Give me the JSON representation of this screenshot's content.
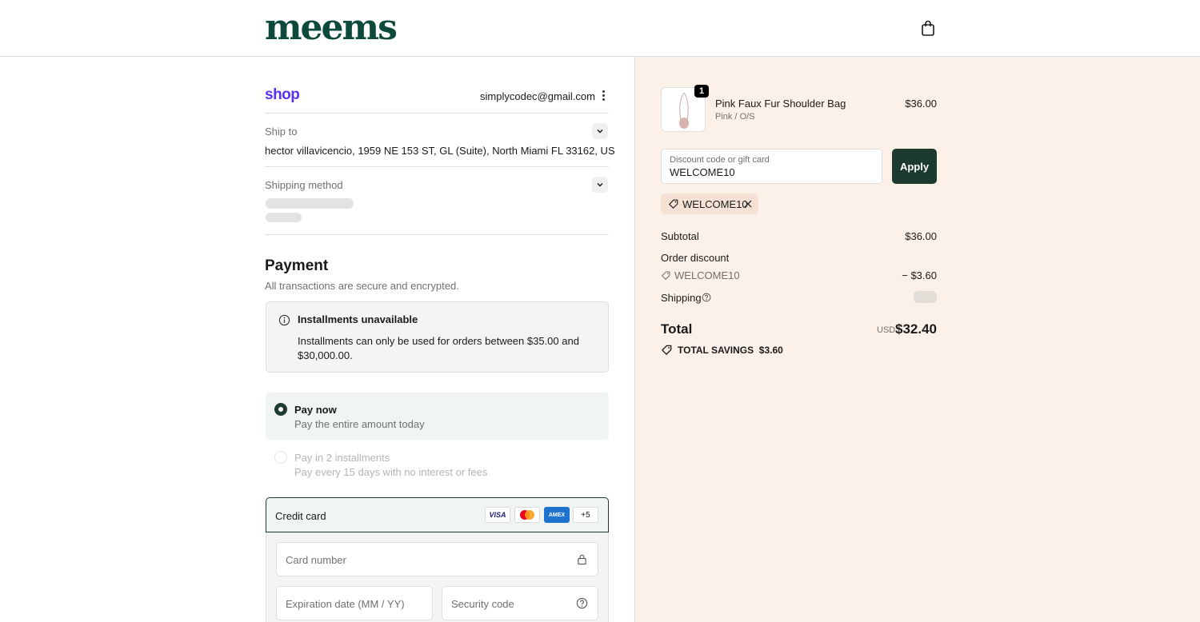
{
  "header": {
    "logo": "meems",
    "bag_icon": "shopping-bag-icon"
  },
  "account": {
    "provider": "shop",
    "email": "simplycodec@gmail.com"
  },
  "ship_to": {
    "label": "Ship to",
    "address": "hector villavicencio, 1959 NE 153 ST, GL (Suite), North Miami FL 33162, US"
  },
  "shipping_method": {
    "label": "Shipping method"
  },
  "payment": {
    "title": "Payment",
    "subtitle": "All transactions are secure and encrypted.",
    "notice": {
      "title": "Installments unavailable",
      "body": "Installments can only be used for orders between $35.00 and $30,000.00."
    },
    "options": [
      {
        "title": "Pay now",
        "subtitle": "Pay the entire amount today",
        "selected": true
      },
      {
        "title": "Pay in 2 installments",
        "subtitle": "Pay every 15 days with no interest or fees",
        "selected": false
      }
    ],
    "credit_card": {
      "label": "Credit card",
      "logos": [
        "VISA",
        "MC",
        "AMEX"
      ],
      "more": "+5",
      "card_number_placeholder": "Card number",
      "expiration_placeholder": "Expiration date (MM / YY)",
      "security_placeholder": "Security code"
    }
  },
  "order": {
    "item": {
      "name": "Pink Faux Fur Shoulder Bag",
      "variant": "Pink / O/S",
      "price": "$36.00",
      "quantity": "1"
    },
    "discount": {
      "label": "Discount code or gift card",
      "value": "WELCOME10",
      "apply": "Apply"
    },
    "applied_code": "WELCOME10",
    "subtotal_label": "Subtotal",
    "subtotal": "$36.00",
    "order_discount_label": "Order discount",
    "order_discount_code": "WELCOME10",
    "order_discount_amount": "− $3.60",
    "shipping_label": "Shipping",
    "total_label": "Total",
    "currency": "USD",
    "total": "$32.40",
    "savings_label": "TOTAL SAVINGS",
    "savings": "$3.60"
  },
  "colors": {
    "brand": "#0d4a3b",
    "accent": "#1d3a30",
    "summary_bg": "#fcf1e9",
    "shop": "#5a31f4"
  }
}
